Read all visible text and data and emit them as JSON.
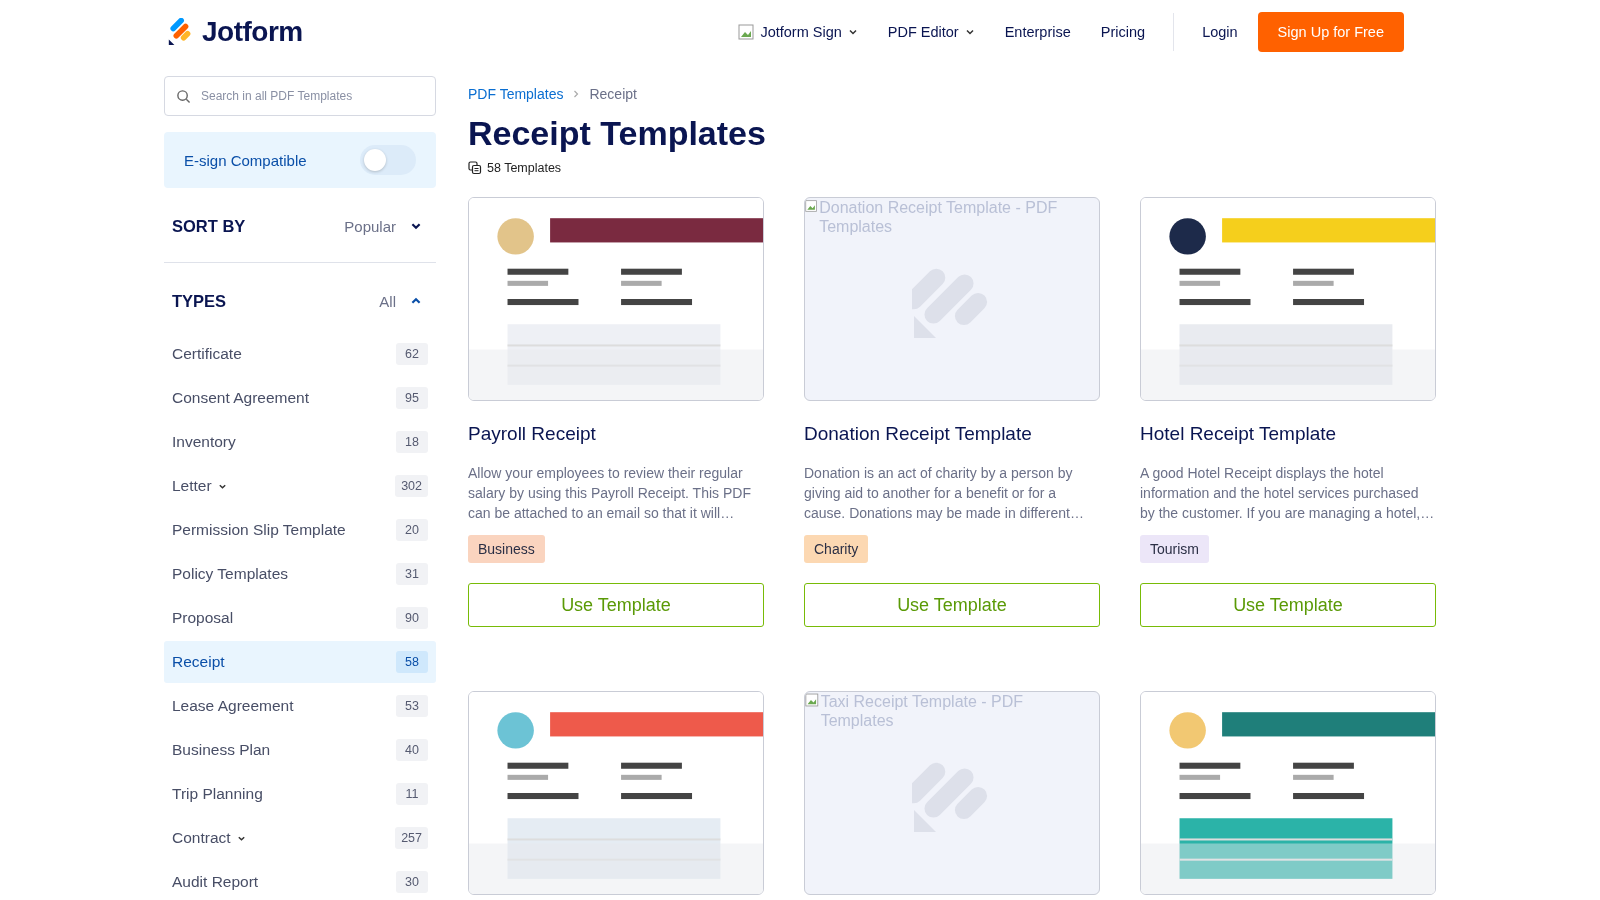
{
  "header": {
    "logo": "Jotform",
    "nav": [
      {
        "label": "Jotform Sign",
        "dropdown": true,
        "broken_icon": true
      },
      {
        "label": "PDF Editor",
        "dropdown": true,
        "broken_icon": false
      },
      {
        "label": "Enterprise",
        "dropdown": false,
        "broken_icon": false
      },
      {
        "label": "Pricing",
        "dropdown": false,
        "broken_icon": false
      }
    ],
    "login": "Login",
    "signup": "Sign Up for Free"
  },
  "sidebar": {
    "search": {
      "placeholder": "Search in all PDF Templates"
    },
    "esign": {
      "label": "E-sign Compatible",
      "on": false
    },
    "sort": {
      "label": "SORT BY",
      "value": "Popular"
    },
    "types": {
      "label": "TYPES",
      "value": "All",
      "expanded": true,
      "items": [
        {
          "label": "Certificate",
          "count": "62",
          "expandable": false,
          "selected": false
        },
        {
          "label": "Consent Agreement",
          "count": "95",
          "expandable": false,
          "selected": false
        },
        {
          "label": "Inventory",
          "count": "18",
          "expandable": false,
          "selected": false
        },
        {
          "label": "Letter",
          "count": "302",
          "expandable": true,
          "selected": false
        },
        {
          "label": "Permission Slip Template",
          "count": "20",
          "expandable": false,
          "selected": false
        },
        {
          "label": "Policy Templates",
          "count": "31",
          "expandable": false,
          "selected": false
        },
        {
          "label": "Proposal",
          "count": "90",
          "expandable": false,
          "selected": false
        },
        {
          "label": "Receipt",
          "count": "58",
          "expandable": false,
          "selected": true
        },
        {
          "label": "Lease Agreement",
          "count": "53",
          "expandable": false,
          "selected": false
        },
        {
          "label": "Business Plan",
          "count": "40",
          "expandable": false,
          "selected": false
        },
        {
          "label": "Trip Planning",
          "count": "11",
          "expandable": false,
          "selected": false
        },
        {
          "label": "Contract",
          "count": "257",
          "expandable": true,
          "selected": false
        },
        {
          "label": "Audit Report",
          "count": "30",
          "expandable": false,
          "selected": false
        }
      ]
    }
  },
  "breadcrumb": [
    {
      "label": "PDF Templates",
      "link": true
    },
    {
      "label": "Receipt",
      "link": false
    }
  ],
  "title": "Receipt Templates",
  "count": "58 Templates",
  "cards": [
    {
      "thumbnail": {
        "kind": "picture"
      },
      "title": "Payroll Receipt",
      "description": "Allow your employees to review their regular salary by using this Payroll Receipt. This PDF can be attached to an email so that it will…",
      "tag": {
        "label": "Business",
        "color": "#fad4bf"
      },
      "button": "Use Template"
    },
    {
      "thumbnail": {
        "kind": "broken",
        "alt": "Donation Receipt Template - PDF Templates"
      },
      "title": "Donation Receipt Template",
      "description": "Donation is an act of charity by a person by giving aid to another for a benefit or for a cause. Donations may be made in different…",
      "tag": {
        "label": "Charity",
        "color": "#fcd8b2"
      },
      "button": "Use Template"
    },
    {
      "thumbnail": {
        "kind": "picture"
      },
      "title": "Hotel Receipt Template",
      "description": "A good Hotel Receipt displays the hotel information and the hotel services purchased by the customer. If you are managing a hotel,…",
      "tag": {
        "label": "Tourism",
        "color": "#ece6f8"
      },
      "button": "Use Template"
    },
    {
      "thumbnail": {
        "kind": "picture"
      }
    },
    {
      "thumbnail": {
        "kind": "broken",
        "alt": "Taxi Receipt Template - PDF Templates"
      }
    },
    {
      "thumbnail": {
        "kind": "picture"
      }
    }
  ]
}
